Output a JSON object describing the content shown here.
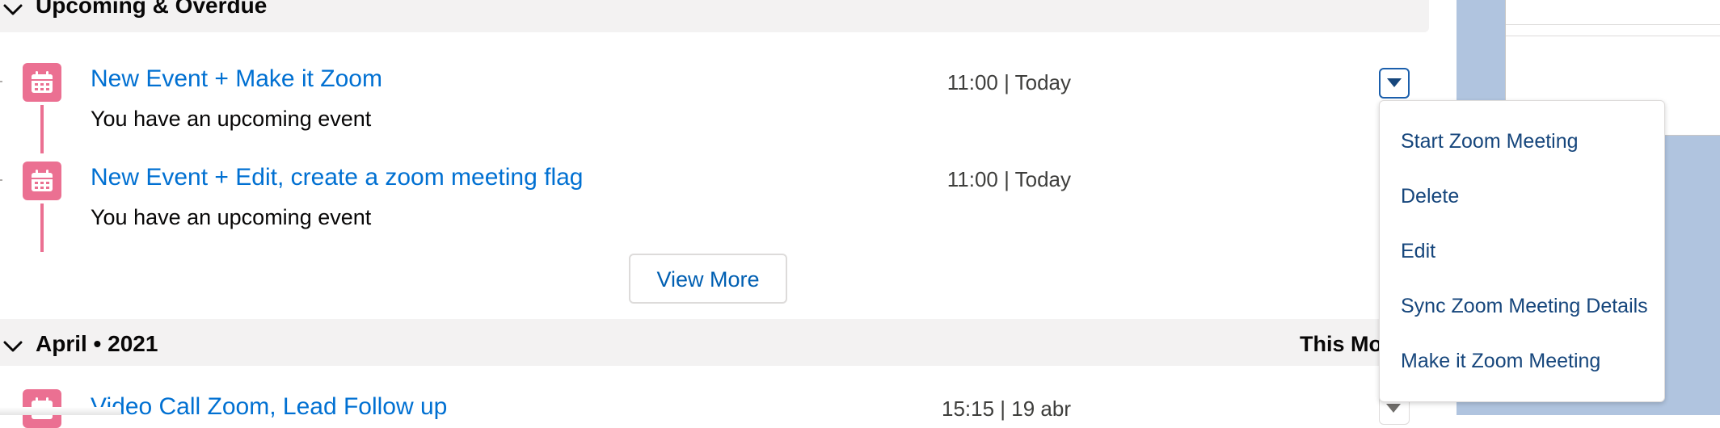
{
  "sections": [
    {
      "title": "Upcoming & Overdue"
    },
    {
      "title": "April • 2021",
      "right_label": "This Mo"
    }
  ],
  "events": [
    {
      "title": "New Event + Make it Zoom",
      "subtitle": "You have an upcoming event",
      "time": "11:00 | Today"
    },
    {
      "title": "New Event + Edit, create a zoom meeting flag",
      "subtitle": "You have an upcoming event",
      "time": "11:00 | Today"
    },
    {
      "title": "Video Call Zoom, Lead Follow up",
      "time": "15:15 | 19 abr"
    }
  ],
  "view_more_label": "View More",
  "dropdown_items": [
    "Start Zoom Meeting",
    "Delete",
    "Edit",
    "Sync Zoom Meeting Details",
    "Make it Zoom Meeting"
  ],
  "colors": {
    "event_icon": "#eb7092",
    "link": "#0070d2",
    "menu_text": "#16467c",
    "header_bg": "#f3f2f2",
    "right_panel": "#b0c4df"
  },
  "icons": {
    "event": "calendar-icon",
    "section_toggle": "chevron-down-icon",
    "row_menu": "caret-down-icon"
  }
}
